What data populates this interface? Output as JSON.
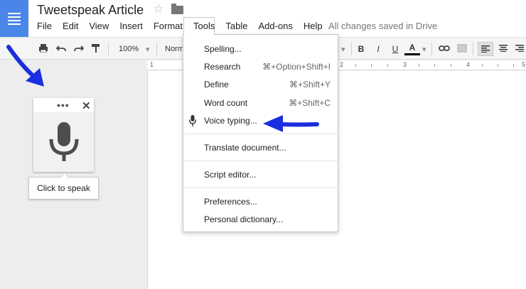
{
  "app": {
    "doc_title": "Tweetspeak Article",
    "save_status": "All changes saved in Drive"
  },
  "menu": [
    "File",
    "Edit",
    "View",
    "Insert",
    "Format",
    "Tools",
    "Table",
    "Add-ons",
    "Help"
  ],
  "toolbar": {
    "zoom": "100%",
    "style": "Norm",
    "bold": "B",
    "italic": "I",
    "underline": "U",
    "text_color": "A"
  },
  "ruler": {
    "numbers": [
      "1",
      "2",
      "3",
      "4",
      "5"
    ]
  },
  "tools_menu": {
    "items": [
      {
        "label": "Spelling...",
        "shortcut": ""
      },
      {
        "label": "Research",
        "shortcut": "⌘+Option+Shift+I"
      },
      {
        "label": "Define",
        "shortcut": "⌘+Shift+Y"
      },
      {
        "label": "Word count",
        "shortcut": "⌘+Shift+C"
      },
      {
        "label": "Voice typing...",
        "shortcut": "",
        "icon": "microphone-icon"
      },
      {
        "label": "Translate document...",
        "shortcut": ""
      },
      {
        "label": "Script editor...",
        "shortcut": ""
      },
      {
        "label": "Preferences...",
        "shortcut": ""
      },
      {
        "label": "Personal dictionary...",
        "shortcut": ""
      }
    ]
  },
  "voice_widget": {
    "tooltip": "Click to speak",
    "more": "•••",
    "close": "✕"
  },
  "colors": {
    "docs_blue": "#4a86e8",
    "arrow_blue": "#1a2fe0"
  }
}
